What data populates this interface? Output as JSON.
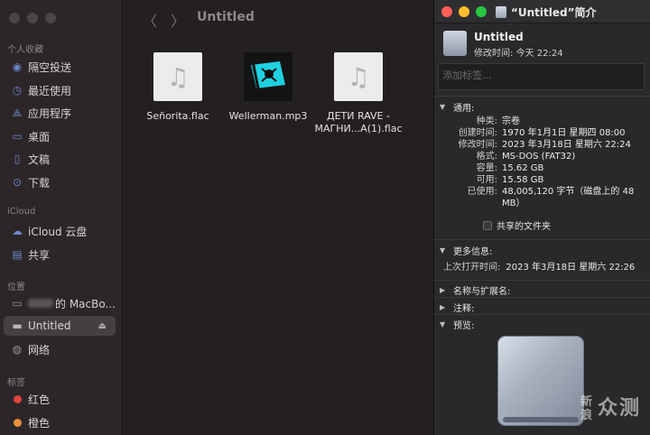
{
  "finder": {
    "window_title": "Untitled",
    "sidebar": {
      "sections": {
        "favorites": "个人收藏",
        "icloud": "iCloud",
        "locations": "位置",
        "tags": "标签"
      },
      "favorites": [
        {
          "label": "隔空投送",
          "icon": "airdrop-icon"
        },
        {
          "label": "最近使用",
          "icon": "clock-icon"
        },
        {
          "label": "应用程序",
          "icon": "apps-icon"
        },
        {
          "label": "桌面",
          "icon": "desktop-icon"
        },
        {
          "label": "文稿",
          "icon": "document-icon"
        },
        {
          "label": "下载",
          "icon": "download-icon"
        }
      ],
      "icloud": [
        {
          "label": "iCloud 云盘",
          "icon": "cloud-icon"
        },
        {
          "label": "共享",
          "icon": "shared-folder-icon"
        }
      ],
      "locations": {
        "macbook_suffix": "的 MacBo...",
        "untitled": "Untitled",
        "network": "网络"
      },
      "tags": [
        {
          "label": "红色",
          "color": "#e0443e"
        },
        {
          "label": "橙色",
          "color": "#e8913a"
        }
      ]
    },
    "files": [
      {
        "name": "Señorita.flac",
        "kind": "audio"
      },
      {
        "name": "Wellerman.mp3",
        "kind": "artwork"
      },
      {
        "name_line1": "ДЕТИ RAVE -",
        "name_line2": "МАГНИ...А(1).flac",
        "kind": "audio"
      }
    ]
  },
  "info": {
    "title": "“Untitled”简介",
    "name": "Untitled",
    "modified_label": "修改时间:",
    "modified_value": "今天 22:24",
    "tag_placeholder": "添加标签...",
    "general": {
      "header": "通用:",
      "rows": [
        {
          "k": "种类:",
          "v": "宗卷"
        },
        {
          "k": "创建时间:",
          "v": "1970 年1月1日 星期四 08:00"
        },
        {
          "k": "修改时间:",
          "v": "2023 年3月18日 星期六 22:24"
        },
        {
          "k": "格式:",
          "v": "MS-DOS (FAT32)"
        },
        {
          "k": "容量:",
          "v": "15.62 GB"
        },
        {
          "k": "可用:",
          "v": "15.58 GB"
        },
        {
          "k": "已使用:",
          "v": "48,005,120 字节（磁盘上的 48 MB）"
        }
      ],
      "shared_folder": "共享的文件夹"
    },
    "more_info": {
      "header": "更多信息:",
      "last_opened_label": "上次打开时间:",
      "last_opened_value": "2023 年3月18日 星期六 22:26"
    },
    "name_ext_header": "名称与扩展名:",
    "comments_header": "注释:",
    "preview_header": "预览:",
    "traffic_colors": [
      "#fe5f57",
      "#febc2e",
      "#28c840"
    ]
  },
  "watermark": {
    "small_top": "新",
    "small_bottom": "浪",
    "main": "众测"
  }
}
